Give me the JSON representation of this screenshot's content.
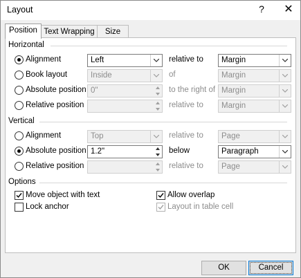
{
  "window": {
    "title": "Layout",
    "help": "?",
    "close": "✕"
  },
  "tabs": [
    {
      "label": "Position"
    },
    {
      "label": "Text Wrapping"
    },
    {
      "label": "Size"
    }
  ],
  "horizontal": {
    "heading": "Horizontal",
    "rows": [
      {
        "label": "Alignment",
        "selected": true,
        "value": "Left",
        "relation": "relative to",
        "relation_value": "Margin"
      },
      {
        "label": "Book layout",
        "value": "Inside",
        "relation": "of",
        "relation_value": "Margin"
      },
      {
        "label": "Absolute position",
        "value": "0\"",
        "relation": "to the right of",
        "relation_value": "Margin"
      },
      {
        "label": "Relative position",
        "value": "",
        "relation": "relative to",
        "relation_value": "Margin"
      }
    ]
  },
  "vertical": {
    "heading": "Vertical",
    "rows": [
      {
        "label": "Alignment",
        "value": "Top",
        "relation": "relative to",
        "relation_value": "Page"
      },
      {
        "label": "Absolute position",
        "selected": true,
        "value": "1.2\"",
        "relation": "below",
        "relation_value": "Paragraph"
      },
      {
        "label": "Relative position",
        "value": "",
        "relation": "relative to",
        "relation_value": "Page"
      }
    ]
  },
  "options": {
    "heading": "Options",
    "move_with_text": {
      "label": "Move object with text",
      "checked": true
    },
    "lock_anchor": {
      "label": "Lock anchor",
      "checked": false
    },
    "allow_overlap": {
      "label": "Allow overlap",
      "checked": true
    },
    "layout_in_cell": {
      "label": "Layout in table cell",
      "checked": true,
      "disabled": true
    }
  },
  "buttons": {
    "ok": "OK",
    "cancel": "Cancel"
  }
}
